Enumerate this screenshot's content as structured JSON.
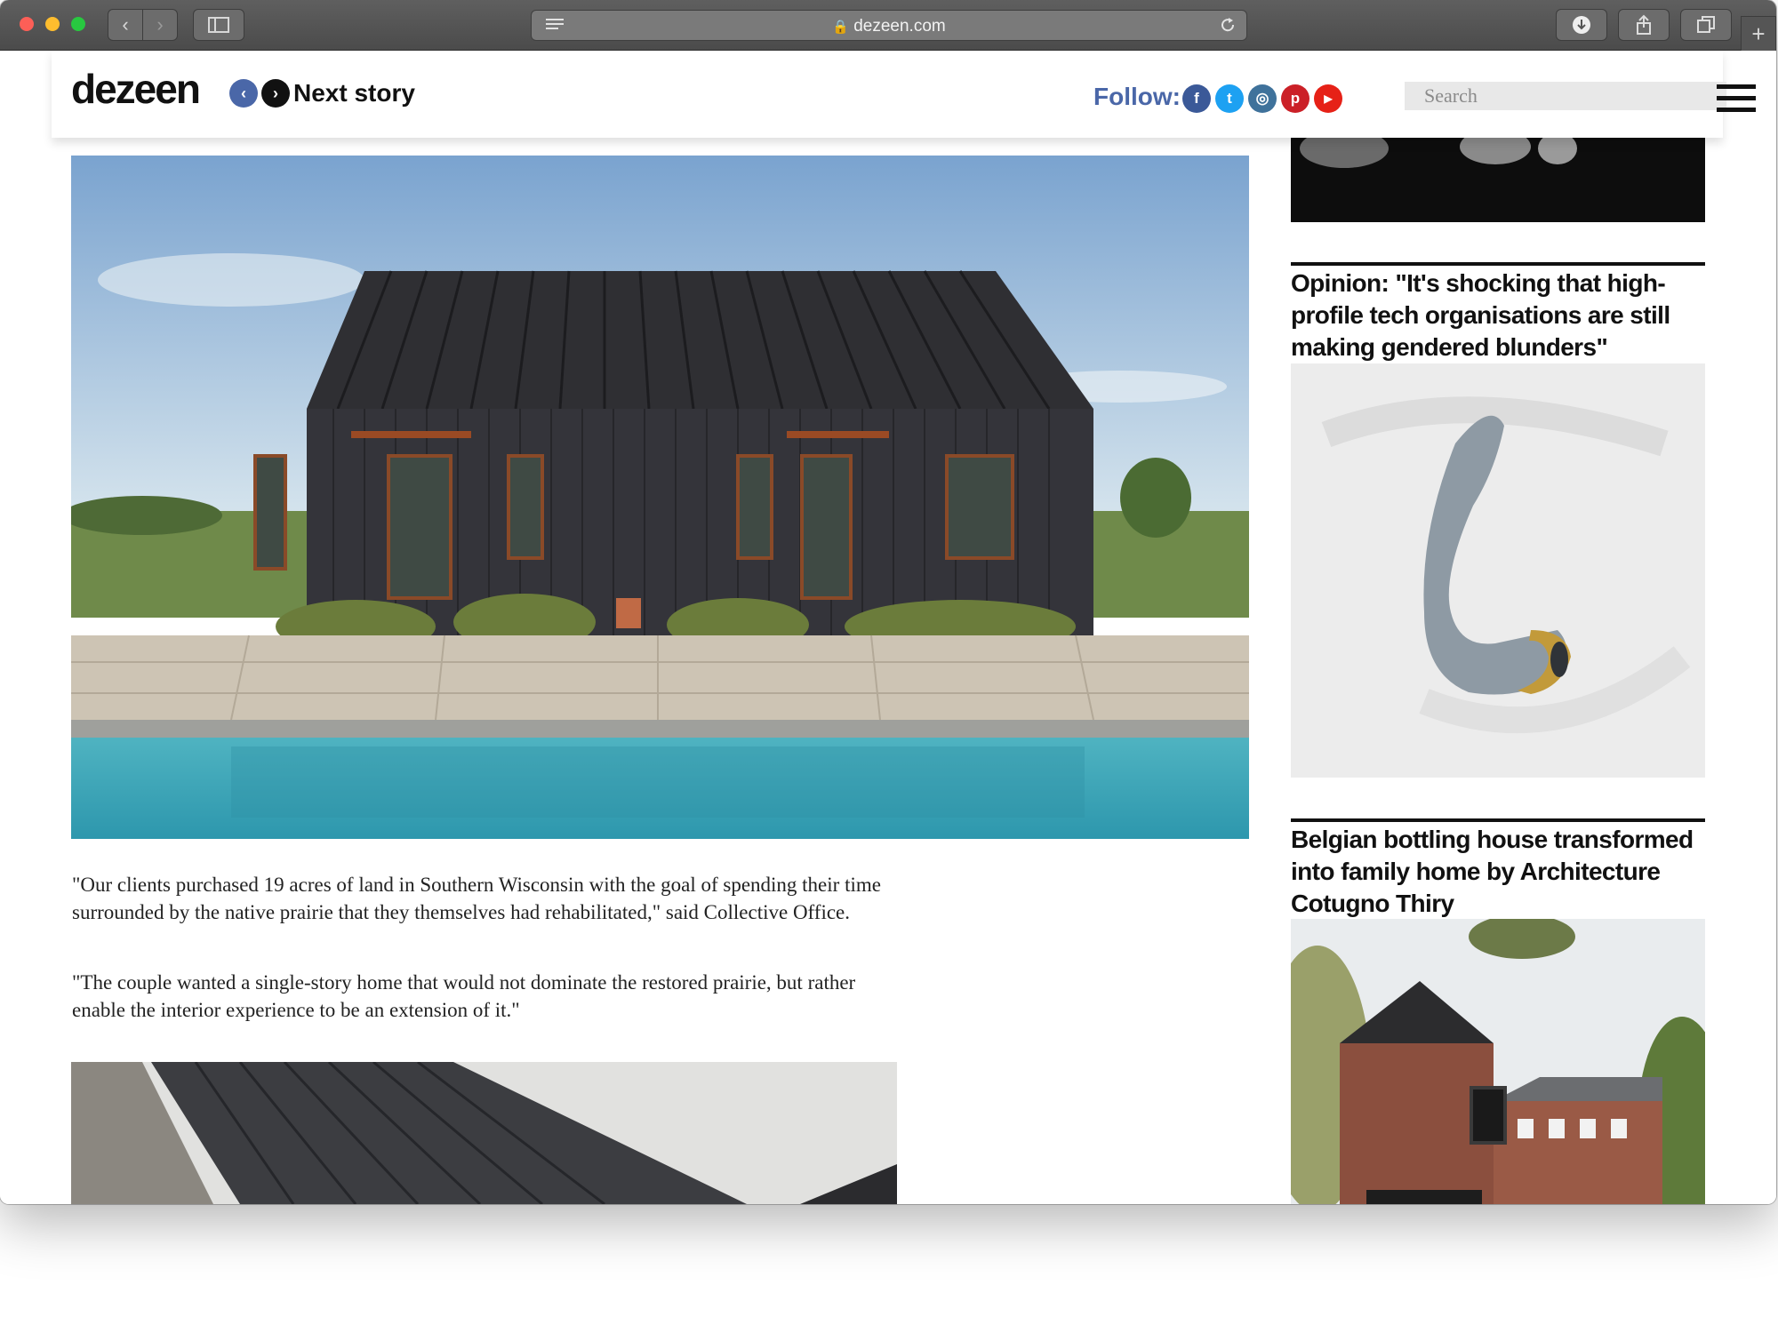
{
  "browser": {
    "url": "dezeen.com",
    "reader_icon": "reader-view-icon",
    "reload_icon": "reload-icon"
  },
  "header": {
    "logo": "dezeen",
    "prev_icon": "‹",
    "next_icon": "›",
    "next_story": "Next story",
    "follow_label": "Follow:",
    "social": [
      {
        "name": "facebook-icon",
        "glyph": "f",
        "color": "#3b5998"
      },
      {
        "name": "twitter-icon",
        "glyph": "t",
        "color": "#1da1f2"
      },
      {
        "name": "instagram-icon",
        "glyph": "◎",
        "color": "#3f729b"
      },
      {
        "name": "pinterest-icon",
        "glyph": "p",
        "color": "#cb2027"
      },
      {
        "name": "youtube-icon",
        "glyph": "▶",
        "color": "#e62117"
      }
    ],
    "search_placeholder": "Search"
  },
  "article": {
    "paragraph_1": "\"Our clients purchased 19 acres of land in Southern Wisconsin with the goal of spending their time surrounded by the native prairie that they themselves had rehabilitated,\" said Collective Office.",
    "paragraph_2": "\"The couple wanted a single-story home that would not dominate the restored prairie, but rather enable the interior experience to be an extension of it.\""
  },
  "sidebar": {
    "stories": [
      {
        "title": "Opinion: \"It's shocking that high-profile tech organisations are still making gendered blunders\""
      },
      {
        "title": "Belgian bottling house transformed into family home by Architecture Cotugno Thiry"
      }
    ]
  },
  "colors": {
    "toolbar": "#4f4f4f",
    "follow": "#4a67a8",
    "pool": "#3aa7b8"
  }
}
